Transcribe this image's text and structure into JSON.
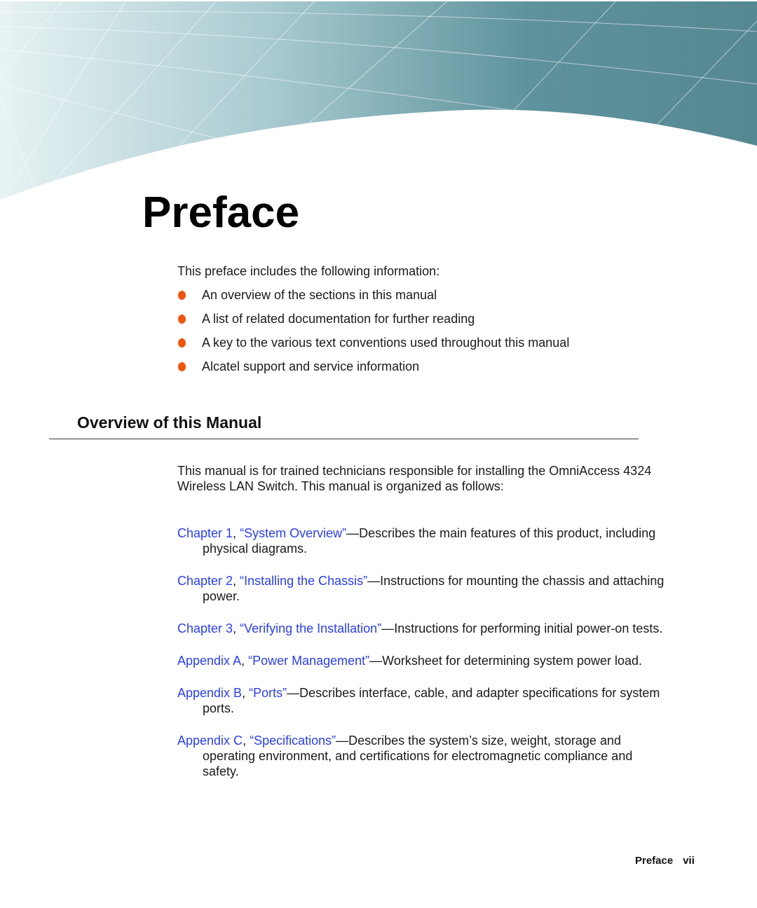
{
  "page": {
    "title": "Preface",
    "intro": "This preface includes the following information:",
    "bullets": [
      "An overview of the sections in this manual",
      "A list of related documentation for further reading",
      "A key to the various text conventions used throughout this manual",
      "Alcatel support and service information"
    ],
    "bullet_color": "#f0550e",
    "link_color": "#2a3ef0"
  },
  "section": {
    "heading": "Overview of this Manual",
    "paragraph": "This manual is for trained technicians responsible for installing the OmniAccess 4324 Wireless LAN Switch. This manual is organized as follows:",
    "entries": [
      {
        "ref": "Chapter 1",
        "title": "“System Overview”",
        "desc": "—Describes the main features of this product, including physical diagrams."
      },
      {
        "ref": "Chapter 2",
        "title": "“Installing the Chassis”",
        "desc": "—Instructions for mounting the chassis and attaching power."
      },
      {
        "ref": "Chapter 3",
        "title": "“Verifying the Installation”",
        "desc": "—Instructions for performing initial power-on tests."
      },
      {
        "ref": "Appendix A",
        "title": "“Power Management”",
        "desc": "—Worksheet for determining system power load."
      },
      {
        "ref": "Appendix B",
        "title": "“Ports”",
        "desc": "—Describes interface, cable, and adapter specifications for system ports."
      },
      {
        "ref": "Appendix C",
        "title": "“Specifications”",
        "desc": "—Describes the system’s size, weight, storage and operating environment, and certifications for electromagnetic compliance and safety."
      }
    ]
  },
  "footer": {
    "section": "Preface",
    "page_number": "vii"
  }
}
